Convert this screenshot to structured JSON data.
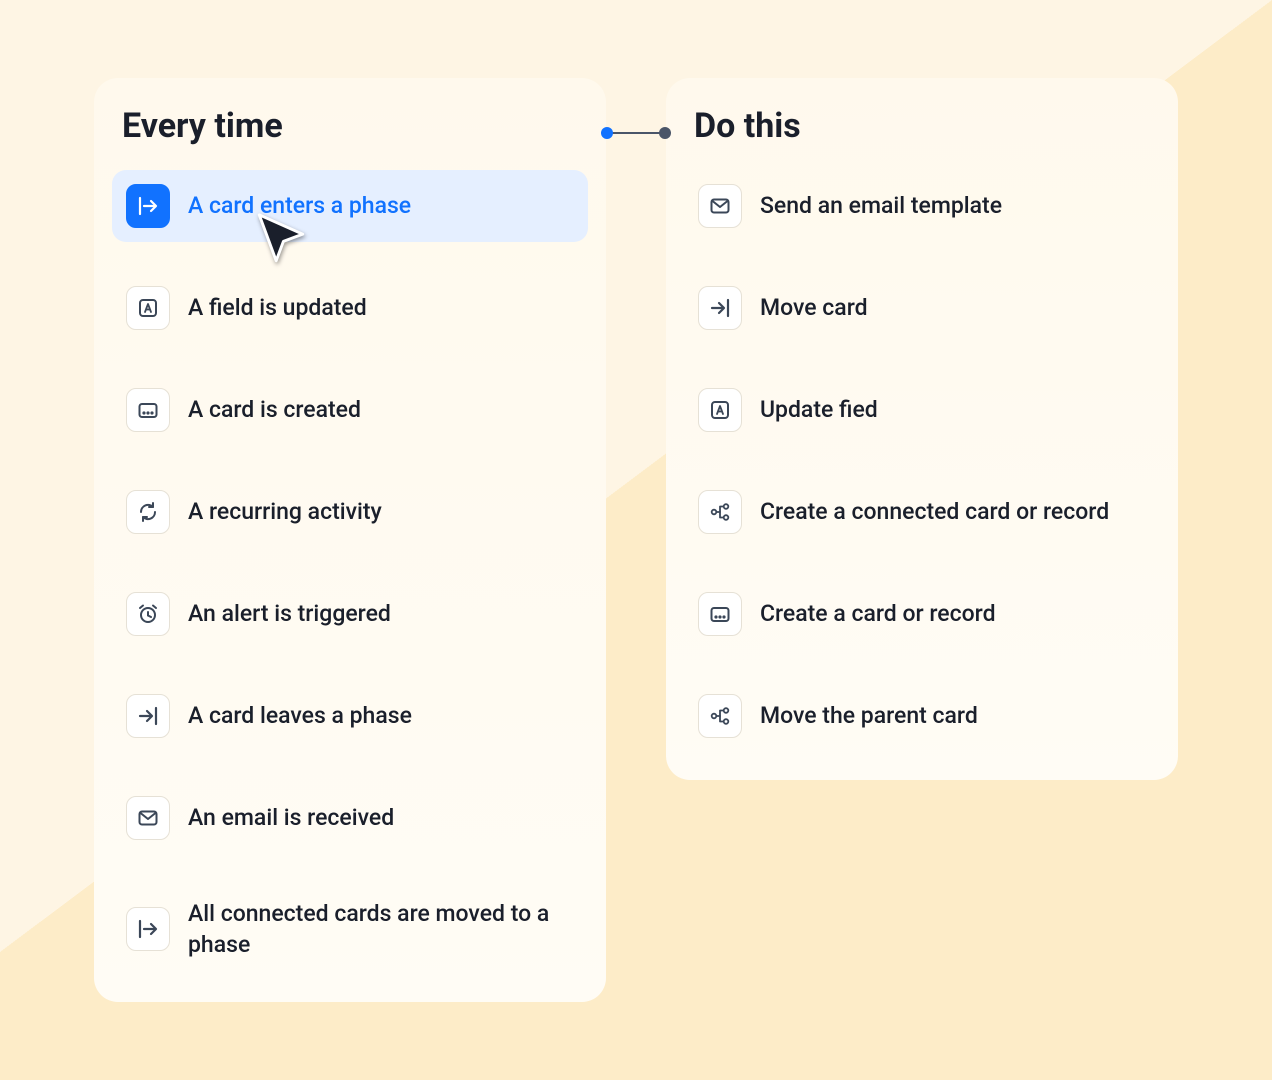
{
  "triggers": {
    "title": "Every time",
    "items": [
      {
        "label": "A card enters a phase",
        "icon": "enter-phase-icon",
        "selected": true
      },
      {
        "label": "A field is updated",
        "icon": "field-a-icon",
        "selected": false
      },
      {
        "label": "A card is created",
        "icon": "card-created-icon",
        "selected": false
      },
      {
        "label": "A recurring activity",
        "icon": "recurring-icon",
        "selected": false
      },
      {
        "label": "An alert is triggered",
        "icon": "alert-clock-icon",
        "selected": false
      },
      {
        "label": "A card leaves a phase",
        "icon": "leave-phase-icon",
        "selected": false
      },
      {
        "label": "An email is received",
        "icon": "email-icon",
        "selected": false
      },
      {
        "label": "All connected cards are moved to a phase",
        "icon": "enter-phase-icon",
        "selected": false
      }
    ]
  },
  "actions": {
    "title": "Do this",
    "items": [
      {
        "label": "Send an email template",
        "icon": "email-icon"
      },
      {
        "label": "Move card",
        "icon": "leave-phase-icon"
      },
      {
        "label": "Update fied",
        "icon": "field-a-icon"
      },
      {
        "label": "Create a connected card or record",
        "icon": "connected-icon"
      },
      {
        "label": "Create a card or record",
        "icon": "card-created-icon"
      },
      {
        "label": "Move the parent card",
        "icon": "connected-icon"
      }
    ]
  },
  "colors": {
    "accent": "#1172ff",
    "selected_bg": "#e5efff",
    "text": "#1a1f2b",
    "icon": "#3b4758"
  }
}
